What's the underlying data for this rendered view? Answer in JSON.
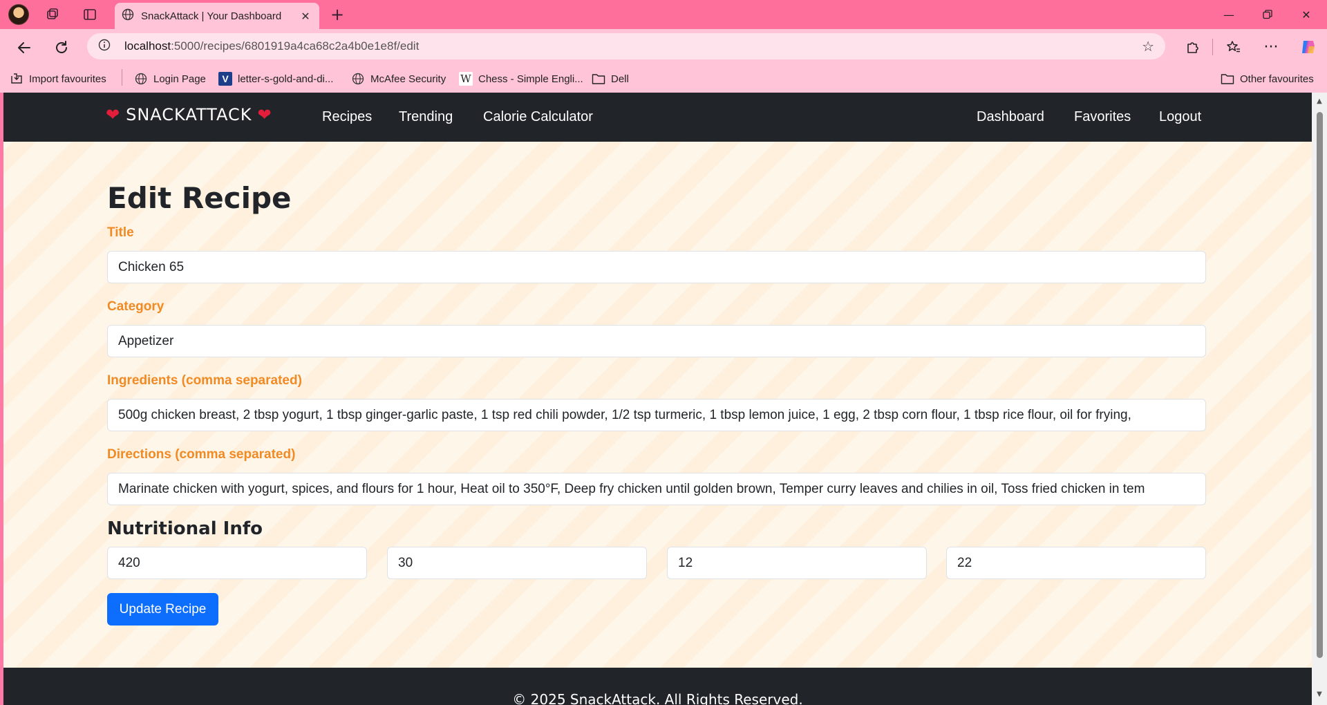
{
  "browser": {
    "tab_title": "SnackAttack | Your Dashboard",
    "url_host": "localhost",
    "url_path": ":5000/recipes/6801919a4ca68c2a4b0e1e8f/edit",
    "bookmarks": [
      {
        "label": "Import favourites",
        "icon": "import-icon"
      },
      {
        "label": "Login Page",
        "icon": "globe-icon"
      },
      {
        "label": "letter-s-gold-and-di...",
        "icon": "v-logo-icon"
      },
      {
        "label": "McAfee Security",
        "icon": "globe-icon"
      },
      {
        "label": "Chess - Simple Engli...",
        "icon": "wikipedia-icon"
      },
      {
        "label": "Dell",
        "icon": "folder-icon"
      }
    ],
    "other_favourites": "Other favourites"
  },
  "navbar": {
    "brand": "SNACKATTACK",
    "left_links": [
      "Recipes",
      "Trending",
      "Calorie Calculator"
    ],
    "right_links": [
      "Dashboard",
      "Favorites",
      "Logout"
    ]
  },
  "form": {
    "heading": "Edit Recipe",
    "title_label": "Title",
    "title_value": "Chicken 65",
    "category_label": "Category",
    "category_value": "Appetizer",
    "ingredients_label": "Ingredients (comma separated)",
    "ingredients_value": "500g chicken breast, 2 tbsp yogurt, 1 tbsp ginger-garlic paste, 1 tsp red chili powder, 1/2 tsp turmeric, 1 tbsp lemon juice, 1 egg, 2 tbsp corn flour, 1 tbsp rice flour, oil for frying,",
    "directions_label": "Directions (comma separated)",
    "directions_value": "Marinate chicken with yogurt, spices, and flours for 1 hour, Heat oil to 350°F, Deep fry chicken until golden brown, Temper curry leaves and chilies in oil, Toss fried chicken in tem",
    "nutrition_heading": "Nutritional Info",
    "nutrition_values": [
      "420",
      "30",
      "12",
      "22"
    ],
    "submit_label": "Update Recipe"
  },
  "footer": {
    "text": "© 2025 SnackAttack. All Rights Reserved."
  },
  "colors": {
    "tabbar": "#ff6f9c",
    "toolbar": "#ffc4d8",
    "navbar": "#212529",
    "label_orange": "#f08a24",
    "primary": "#0d6efd",
    "heart": "#e41e3a"
  }
}
